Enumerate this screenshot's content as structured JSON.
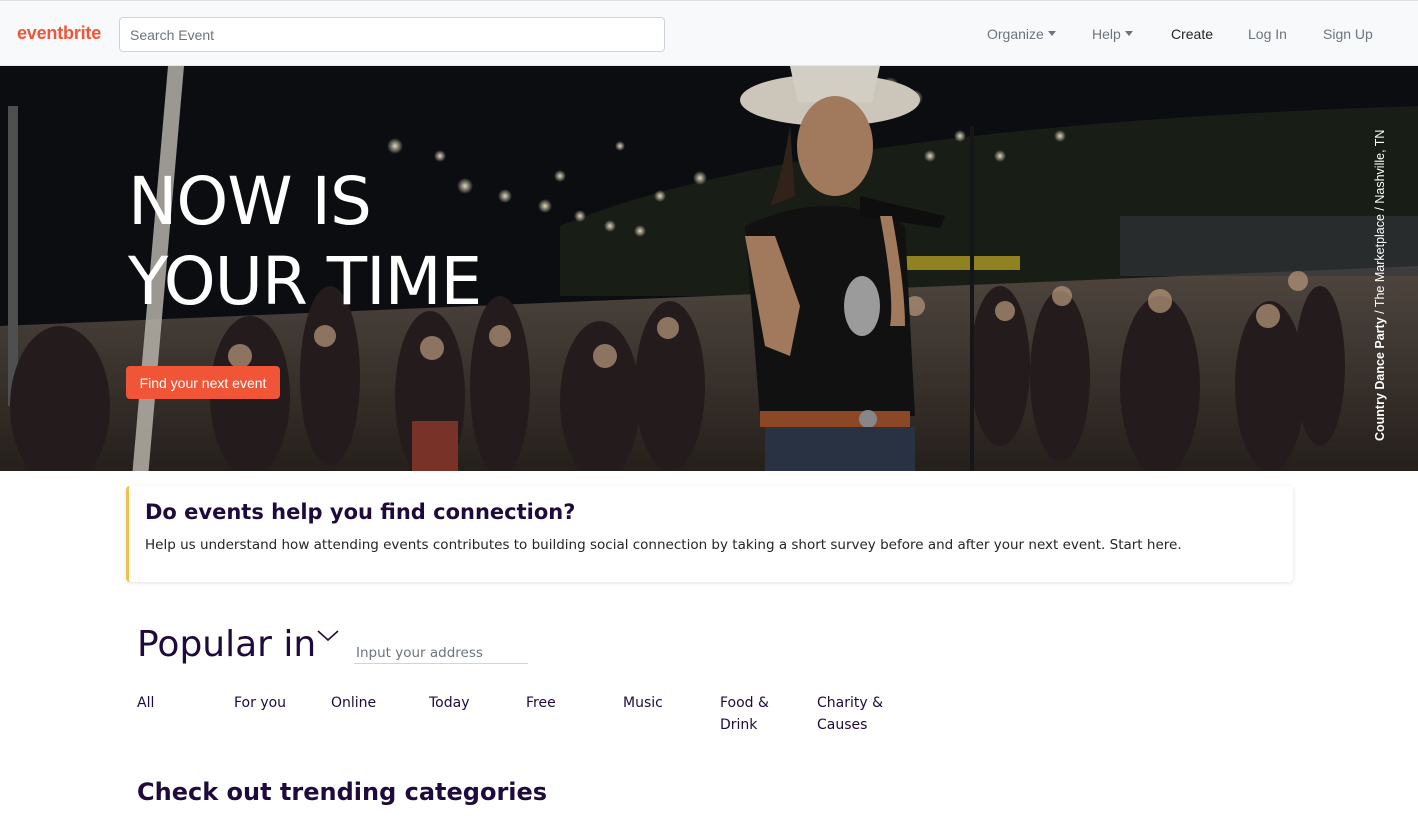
{
  "navbar": {
    "brand": "eventbrite",
    "search_placeholder": "Search Event",
    "organize": "Organize",
    "help": "Help",
    "create": "Create",
    "login": "Log In",
    "signup": "Sign Up"
  },
  "hero": {
    "title_line1": "NOW IS",
    "title_line2": "YOUR TIME",
    "cta": "Find your next event",
    "caption_bold": "Country Dance Party",
    "caption_rest": " / The Marketplace / Nashville, TN"
  },
  "survey": {
    "title": "Do events help you find connection?",
    "text": "Help us understand how attending events contributes to building social connection by taking a short survey before and after your next event. Start here."
  },
  "popular": {
    "title": "Popular in",
    "address_placeholder": "Input your address",
    "tabs": [
      "All",
      "For you",
      "Online",
      "Today",
      "Free",
      "Music",
      "Food & Drink",
      "Charity & Causes"
    ]
  },
  "trending": {
    "title": "Check out trending categories"
  },
  "colors": {
    "brand": "#f05537",
    "survey_accent": "#f0c14b",
    "text_primary": "#1e0a3c"
  }
}
